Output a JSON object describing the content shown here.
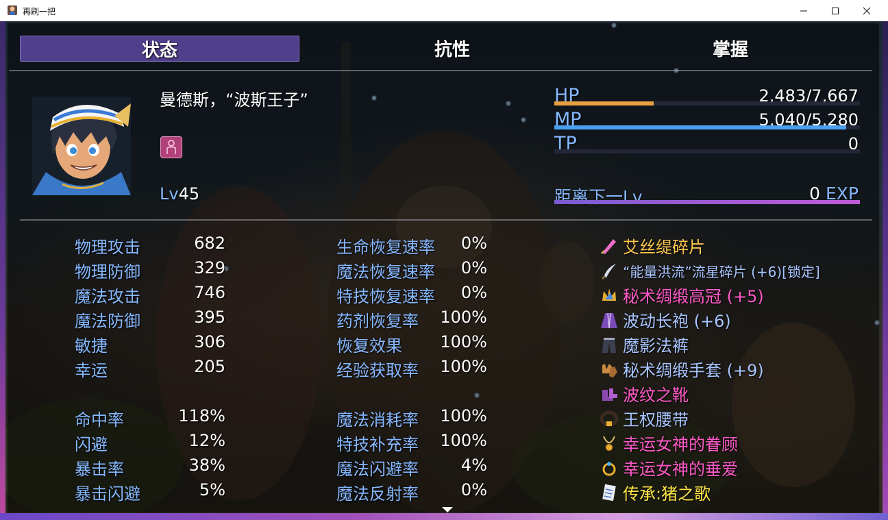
{
  "window": {
    "title": "再刷一把"
  },
  "tabs": [
    {
      "label": "状态",
      "active": true
    },
    {
      "label": "抗性",
      "active": false
    },
    {
      "label": "掌握",
      "active": false
    }
  ],
  "actor": {
    "name": "曼德斯，“波斯王子”",
    "level_tag": "Lv",
    "level": "45"
  },
  "gauges": {
    "hp": {
      "label": "HP",
      "value": "2,483/7,667",
      "ratio": 0.324,
      "color": "#e8a040"
    },
    "mp": {
      "label": "MP",
      "value": "5,040/5,280",
      "ratio": 0.955,
      "color": "#4aa0f0"
    },
    "tp": {
      "label": "TP",
      "value": "0",
      "ratio": 0,
      "color": "#40c080"
    }
  },
  "exp": {
    "label": "距离下一Lv",
    "amount": "0",
    "unit": "EXP"
  },
  "stats_left": [
    {
      "name": "物理攻击",
      "value": "682"
    },
    {
      "name": "物理防御",
      "value": "329"
    },
    {
      "name": "魔法攻击",
      "value": "746"
    },
    {
      "name": "魔法防御",
      "value": "395"
    },
    {
      "name": "敏捷",
      "value": "306"
    },
    {
      "name": "幸运",
      "value": "205"
    },
    {
      "name": "命中率",
      "value": "118%"
    },
    {
      "name": "闪避",
      "value": "12%"
    },
    {
      "name": "暴击率",
      "value": "38%"
    },
    {
      "name": "暴击闪避",
      "value": "5%"
    }
  ],
  "stats_right": [
    {
      "name": "生命恢复速率",
      "value": "0%"
    },
    {
      "name": "魔法恢复速率",
      "value": "0%"
    },
    {
      "name": "特技恢复速率",
      "value": "0%"
    },
    {
      "name": "药剂恢复率",
      "value": "100%"
    },
    {
      "name": "恢复效果",
      "value": "100%"
    },
    {
      "name": "经验获取率",
      "value": "100%"
    },
    {
      "name": "魔法消耗率",
      "value": "100%"
    },
    {
      "name": "特技补充率",
      "value": "100%"
    },
    {
      "name": "魔法闪避率",
      "value": "4%"
    },
    {
      "name": "魔法反射率",
      "value": "0%"
    }
  ],
  "equipment": [
    {
      "name": "艾丝缇碎片",
      "color": "#ffc850",
      "icon": "crystal-sword-icon"
    },
    {
      "name": "“能量洪流”流星碎片 (+6)[锁定]",
      "color": "#a8c4ff",
      "icon": "curved-blade-icon"
    },
    {
      "name": "秘术绸缎高冠 (+5)",
      "color": "#ff5ac8",
      "icon": "crown-icon"
    },
    {
      "name": "波动长袍 (+6)",
      "color": "#a8c4ff",
      "icon": "robe-icon"
    },
    {
      "name": "魔影法裤",
      "color": "#a8c4ff",
      "icon": "pants-icon"
    },
    {
      "name": "秘术绸缎手套 (+9)",
      "color": "#a8c4ff",
      "icon": "gloves-icon"
    },
    {
      "name": "波纹之靴",
      "color": "#ff5ac8",
      "icon": "boots-icon"
    },
    {
      "name": "王权腰带",
      "color": "#a8c4ff",
      "icon": "belt-icon"
    },
    {
      "name": "幸运女神的眷顾",
      "color": "#ff5ac8",
      "icon": "necklace-icon"
    },
    {
      "name": "幸运女神的垂爱",
      "color": "#ff5ac8",
      "icon": "ring-icon"
    },
    {
      "name": "传承:猪之歌",
      "color": "#ffe64a",
      "icon": "scroll-icon"
    }
  ]
}
